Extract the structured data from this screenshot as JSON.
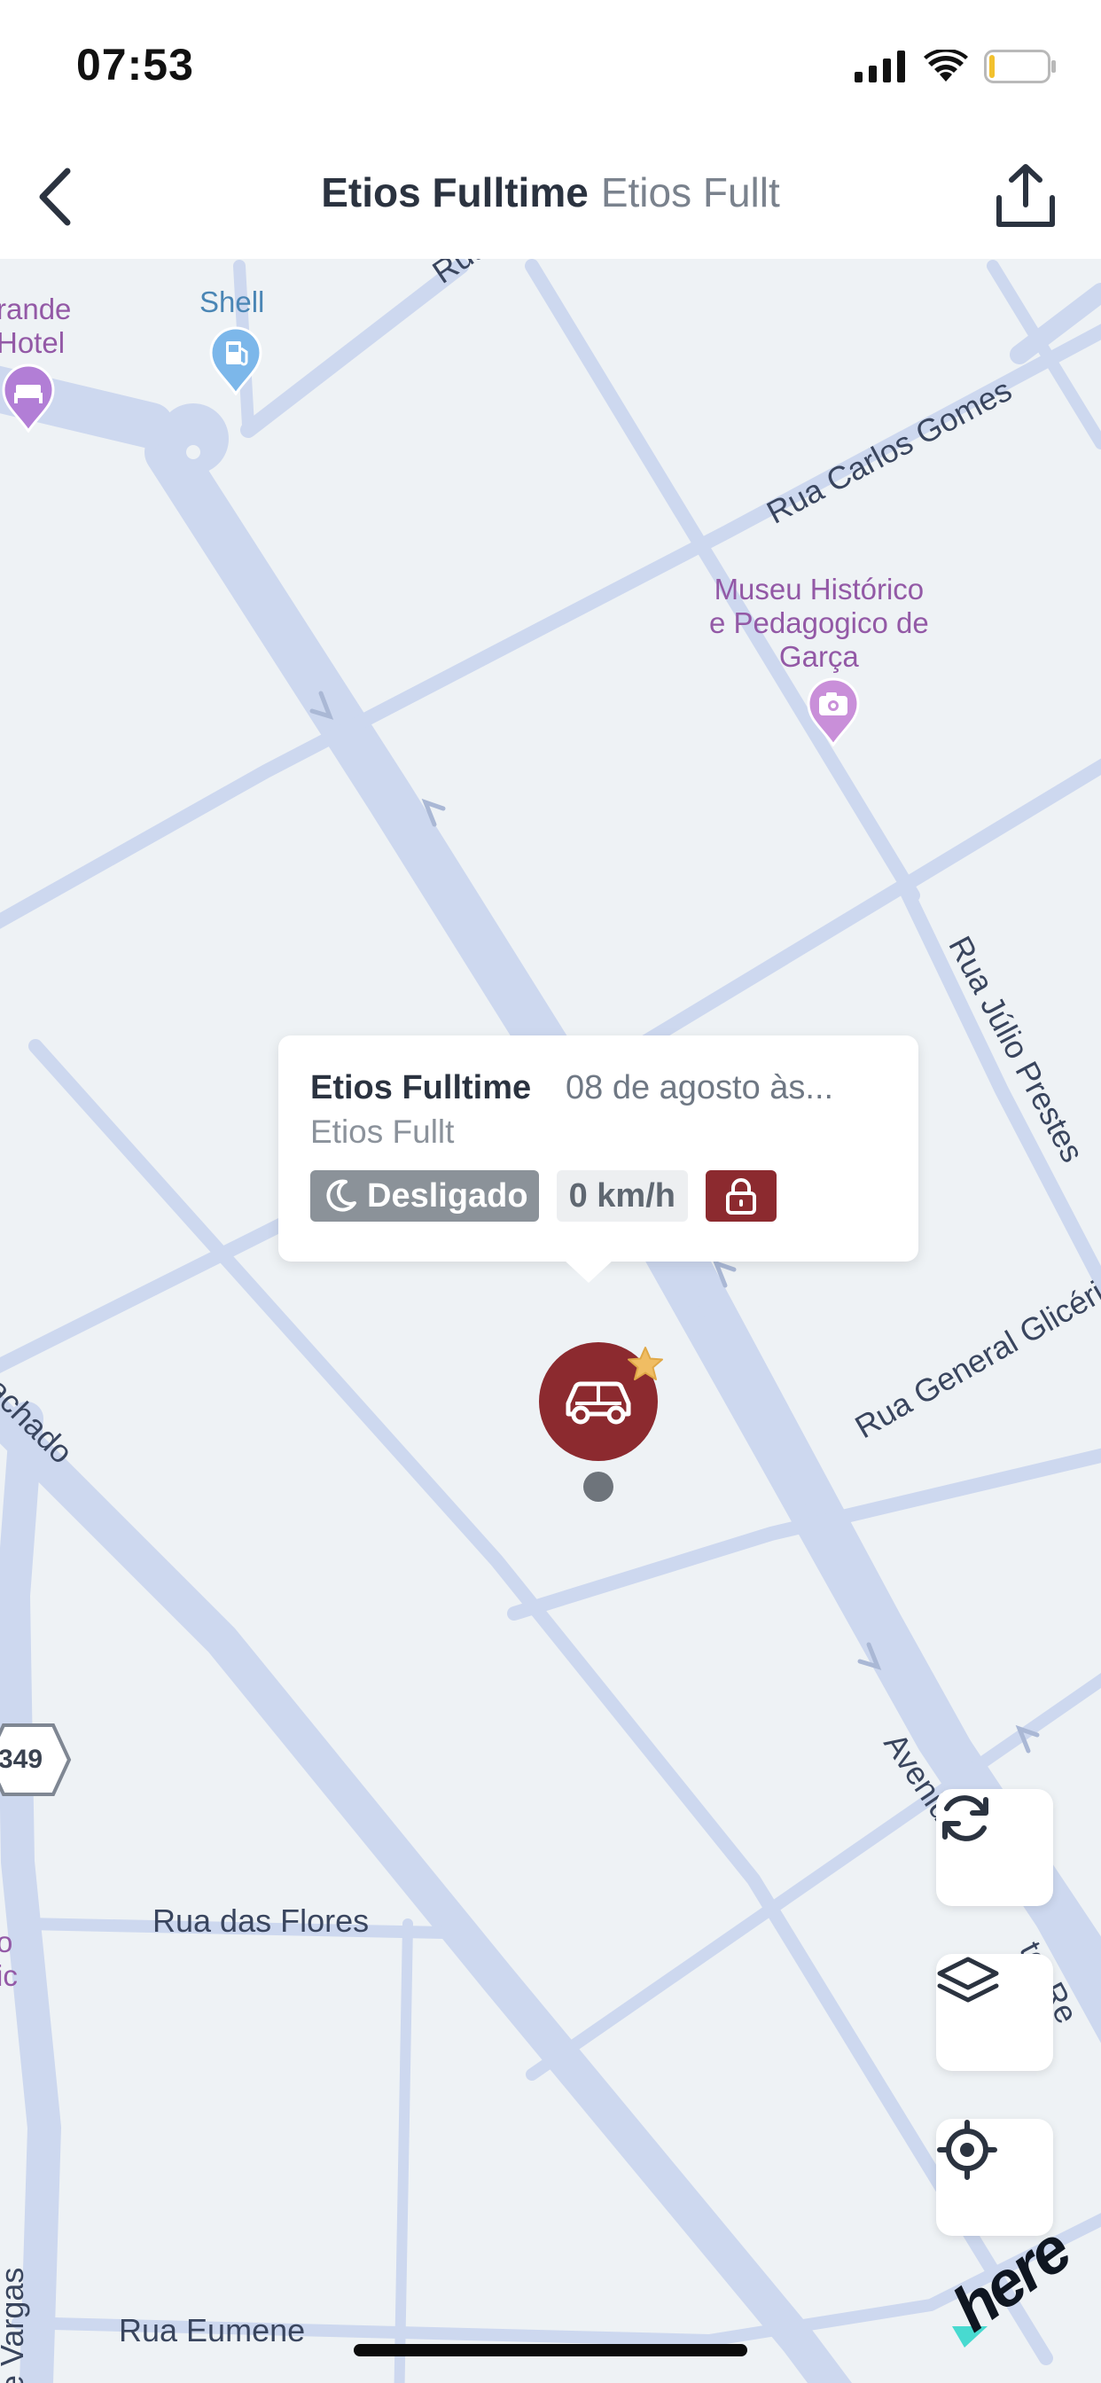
{
  "status_bar": {
    "time": "07:53"
  },
  "header": {
    "back_icon": "chevron-left-icon",
    "title": "Etios Fulltime",
    "subtitle": "Etios Fullt",
    "share_icon": "share-icon"
  },
  "map": {
    "streets": [
      {
        "id": "rua-top",
        "label": "Rua"
      },
      {
        "id": "rua-carlos-gomes",
        "label": "Rua Carlos Gomes"
      },
      {
        "id": "rua-julio-prestes",
        "label": "Rua Júlio Prestes"
      },
      {
        "id": "rua-general-glicerio",
        "label": "Rua General Glicério"
      },
      {
        "id": "avenida",
        "label": "Avenida"
      },
      {
        "id": "tor-re",
        "label": "tor Re"
      },
      {
        "id": "machado",
        "label": "achado"
      },
      {
        "id": "rua-das-flores",
        "label": "Rua das Flores"
      },
      {
        "id": "vargas",
        "label": "te Vargas"
      },
      {
        "id": "rua-eumene",
        "label": "Rua Eumene"
      }
    ],
    "road_shield": "349",
    "pois": [
      {
        "id": "hotel",
        "label": "rande\nHotel",
        "icon": "hotel-icon"
      },
      {
        "id": "shell",
        "label": "Shell",
        "icon": "fuel-icon"
      },
      {
        "id": "museu",
        "label": "Museu Histórico\ne Pedagogico de\nGarça",
        "icon": "camera-icon"
      },
      {
        "id": "left-poi",
        "label": "o\nic"
      }
    ],
    "colors": {
      "background": "#eef2f5",
      "road": "#cdd8ef",
      "poi_purple": "#b27ed6",
      "vehicle": "#8c2a2f"
    }
  },
  "vehicle_popup": {
    "name": "Etios Fulltime",
    "datetime": "08 de agosto às...",
    "plate_label": "Etios Fullt",
    "status_icon": "moon-icon",
    "status": "Desligado",
    "speed": "0 km/h",
    "lock_icon": "padlock-icon"
  },
  "vehicle_marker": {
    "icon": "car-icon",
    "favorite_icon": "star-icon"
  },
  "map_controls": [
    {
      "id": "refresh",
      "icon": "refresh-icon"
    },
    {
      "id": "layers",
      "icon": "layers-icon"
    },
    {
      "id": "locate",
      "icon": "crosshair-icon"
    }
  ],
  "branding": {
    "map_provider": "here"
  }
}
